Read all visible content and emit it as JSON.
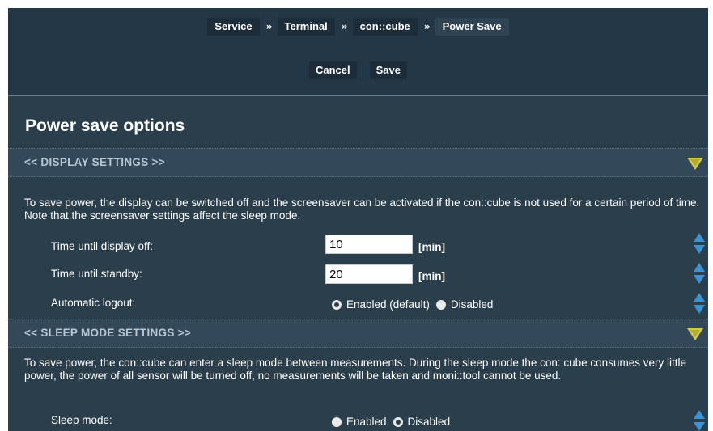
{
  "breadcrumb": {
    "items": [
      "Service",
      "Terminal",
      "con::cube",
      "Power Save"
    ],
    "separator": "››"
  },
  "actions": {
    "cancel": "Cancel",
    "save": "Save"
  },
  "page": {
    "title": "Power save options"
  },
  "display_settings": {
    "title": "<<  DISPLAY SETTINGS  >>",
    "description": "To save power, the display can be switched off and the screensaver can be activated if the con::cube is not used for a certain period of time. Note that the screensaver settings affect the sleep mode.",
    "display_off": {
      "label": "Time until display off:",
      "value": "10",
      "unit": "[min]"
    },
    "standby": {
      "label": "Time until standby:",
      "value": "20",
      "unit": "[min]"
    },
    "auto_logout": {
      "label": "Automatic logout:",
      "options": [
        "Enabled (default)",
        "Disabled"
      ],
      "selected": "Enabled (default)"
    }
  },
  "sleep_settings": {
    "title": "<<  SLEEP MODE SETTINGS  >>",
    "description": "To save power, the con::cube can enter a sleep mode between measurements. During the sleep mode the con::cube consumes very little power, the power of all sensor will be turned off, no measurements will be taken and moni::tool cannot be used.",
    "sleep_mode": {
      "label": "Sleep mode:",
      "options": [
        "Enabled",
        "Disabled"
      ],
      "selected": "Disabled"
    }
  },
  "icons": {
    "collapse": "triangle-down-icon",
    "stepper": "up-down-arrows-icon",
    "breadcrumb_separator": "double-chevron-icon"
  },
  "colors": {
    "background": "#2a3e4c",
    "header": "#243746",
    "section_header": "#33495a",
    "accent_yellow": "#d2c94e",
    "stepper_blue": "#3c93d3"
  }
}
